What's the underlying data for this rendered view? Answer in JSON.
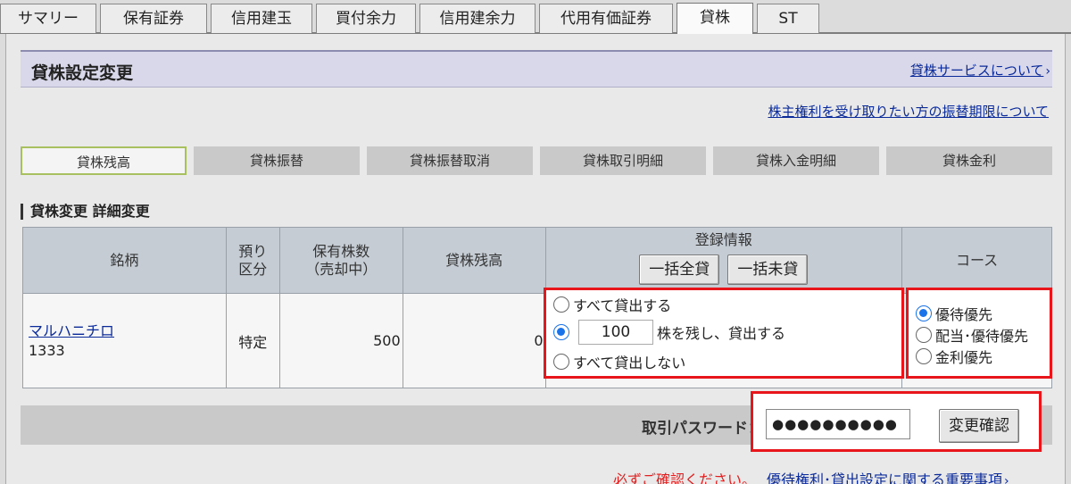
{
  "tabs": [
    {
      "label": "サマリー",
      "active": false
    },
    {
      "label": "保有証券",
      "active": false
    },
    {
      "label": "信用建玉",
      "active": false
    },
    {
      "label": "買付余力",
      "active": false
    },
    {
      "label": "信用建余力",
      "active": false
    },
    {
      "label": "代用有価証券",
      "active": false
    },
    {
      "label": "貸株",
      "active": true
    },
    {
      "label": "ST",
      "active": false
    }
  ],
  "header": {
    "title": "貸株設定変更",
    "service_link": "貸株サービスについて",
    "transfer_link": "株主権利を受け取りたい方の振替期限について"
  },
  "subtabs": [
    {
      "label": "貸株残高",
      "active": true
    },
    {
      "label": "貸株振替",
      "active": false
    },
    {
      "label": "貸株振替取消",
      "active": false
    },
    {
      "label": "貸株取引明細",
      "active": false
    },
    {
      "label": "貸株入金明細",
      "active": false
    },
    {
      "label": "貸株金利",
      "active": false
    }
  ],
  "section_title": "貸株変更 詳細変更",
  "table": {
    "headers": {
      "name": "銘柄",
      "account_line1": "預り",
      "account_line2": "区分",
      "holding_line1": "保有株数",
      "holding_line2": "（売却中）",
      "balance": "貸株残高",
      "registration": "登録情報",
      "course": "コース"
    },
    "bulk_lend_button": "一括全貸",
    "bulk_unlend_button": "一括未貸",
    "row": {
      "name": "マルハニチロ",
      "code": "1333",
      "account": "特定",
      "holding": "500",
      "balance": "0"
    }
  },
  "registration_options": {
    "lend_all": "すべて貸出する",
    "keep_qty_value": "100",
    "keep_qty_suffix": "株を残し、貸出する",
    "lend_none": "すべて貸出しない",
    "selected": "keep_qty"
  },
  "course_options": {
    "items": [
      "優待優先",
      "配当･優待優先",
      "金利優先"
    ],
    "selected_index": 0
  },
  "password": {
    "label": "取引パスワード：",
    "value": "●●●●●●●●●●",
    "confirm_button": "変更確認"
  },
  "footer": {
    "notice": "必ずご確認ください。",
    "link": "優待権利･貸出設定に関する重要事項"
  },
  "colors": {
    "highlight_border": "#e8151b",
    "link": "#0a2a9a",
    "radio_checked": "#1a73e8"
  }
}
